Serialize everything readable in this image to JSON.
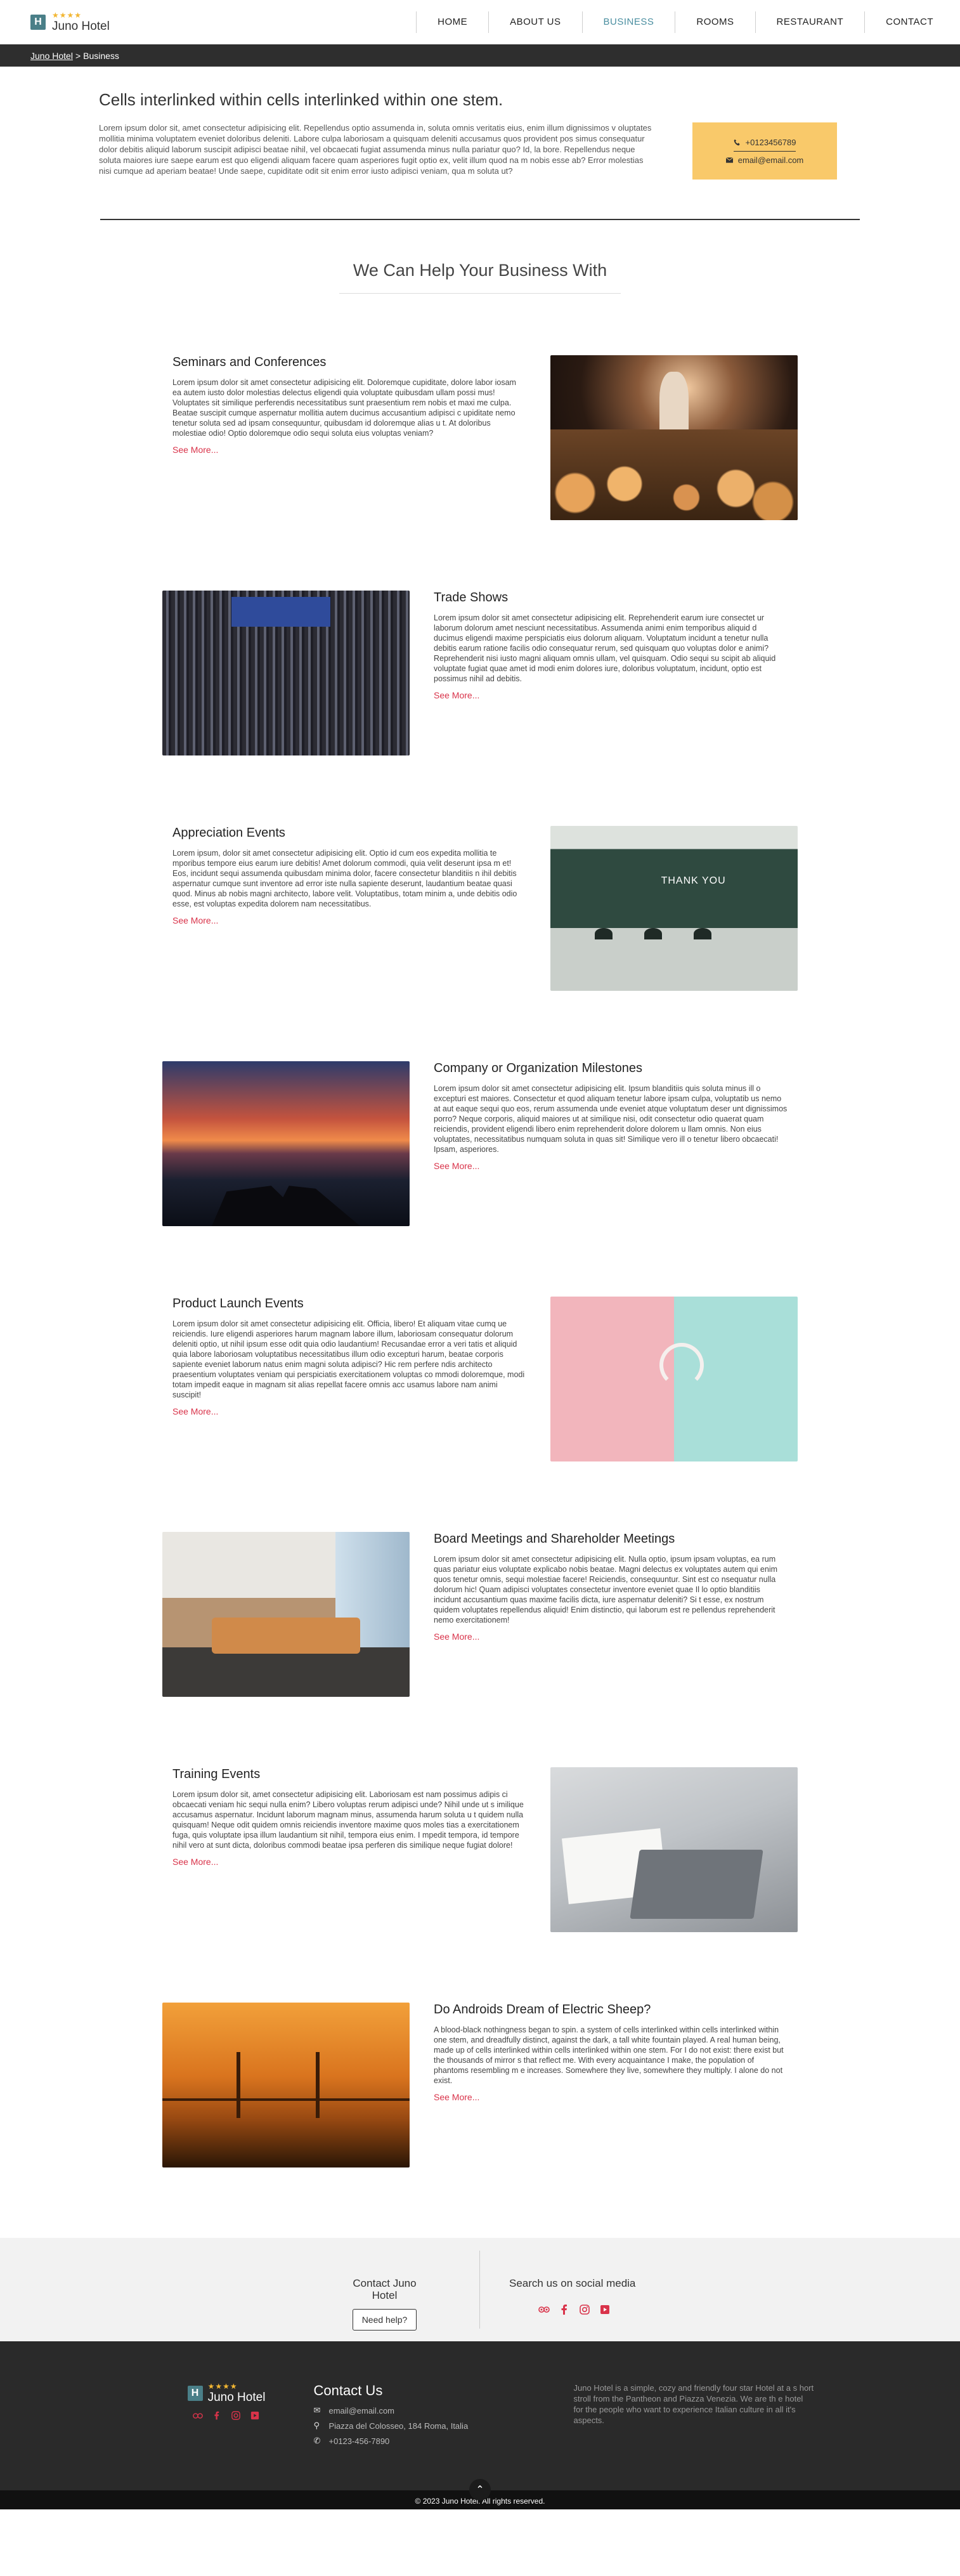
{
  "brand": {
    "logo_letter": "H",
    "stars": "★★★★",
    "name": "Juno Hotel"
  },
  "nav": [
    {
      "label": "HOME",
      "active": false
    },
    {
      "label": "ABOUT US",
      "active": false
    },
    {
      "label": "BUSINESS",
      "active": true
    },
    {
      "label": "ROOMS",
      "active": false
    },
    {
      "label": "RESTAURANT",
      "active": false
    },
    {
      "label": "CONTACT",
      "active": false
    }
  ],
  "breadcrumb": {
    "home": "Juno Hotel",
    "separator": ">",
    "current": "Business"
  },
  "intro": {
    "title": "Cells interlinked within cells interlinked within one stem.",
    "text": "Lorem ipsum dolor sit, amet consectetur adipisicing elit. Repellendus optio assumenda in, soluta omnis veritatis eius, enim illum dignissimos v oluptates mollitia minima voluptatem eveniet doloribus deleniti. Labore culpa laboriosam a quisquam deleniti accusamus quos provident pos simus consequatur dolor debitis aliquid laborum suscipit adipisci beatae nihil, vel obcaecati fugiat assumenda minus nulla pariatur quo? Id, la bore. Repellendus neque soluta maiores iure saepe earum est quo eligendi aliquam facere quam asperiores fugit optio ex, velit illum quod na m nobis esse ab? Error molestias nisi cumque ad aperiam beatae! Unde saepe, cupiditate odit sit enim error iusto adipisci veniam, qua m soluta ut?",
    "phone": "+0123456789",
    "email": "email@email.com"
  },
  "section_title": "We Can Help Your Business With",
  "see_more": "See More...",
  "services": [
    {
      "title": "Seminars and Conferences",
      "image": "seminar",
      "text": "Lorem ipsum dolor sit amet consectetur adipisicing elit. Doloremque cupiditate, dolore labor iosam ea autem iusto dolor molestias delectus eligendi quia voluptate quibusdam ullam possi mus! Voluptates sit similique perferendis necessitatibus sunt praesentium rem nobis et maxi me culpa. Beatae suscipit cumque aspernatur mollitia autem ducimus accusantium adipisci c upiditate nemo tenetur soluta sed ad ipsam consequuntur, quibusdam id doloremque alias u t. At doloribus molestiae odio! Optio doloremque odio sequi soluta eius voluptas veniam?"
    },
    {
      "title": "Trade Shows",
      "image": "trade",
      "text": "Lorem ipsum dolor sit amet consectetur adipisicing elit. Reprehenderit earum iure consectet ur laborum dolorum amet nesciunt necessitatibus. Assumenda animi enim temporibus aliquid d ducimus eligendi maxime perspiciatis eius dolorum aliquam. Voluptatum incidunt a tenetur nulla debitis earum ratione facilis odio consequatur rerum, sed quisquam quo voluptas dolor e animi? Reprehenderit nisi iusto magni aliquam omnis ullam, vel quisquam. Odio sequi su scipit ab aliquid voluptate fugiat quae amet id modi enim dolores iure, doloribus voluptatum, incidunt, optio est possimus nihil ad debitis."
    },
    {
      "title": "Appreciation Events",
      "image": "thanks",
      "sign": "THANK YOU",
      "text": "Lorem ipsum, dolor sit amet consectetur adipisicing elit. Optio id cum eos expedita mollitia te mporibus tempore eius earum iure debitis! Amet dolorum commodi, quia velit deserunt ipsa m et! Eos, incidunt sequi assumenda quibusdam minima dolor, facere consectetur blanditiis n ihil debitis aspernatur cumque sunt inventore ad error iste nulla sapiente deserunt, laudantium beatae quasi quod. Minus ab nobis magni architecto, labore velit. Voluptatibus, totam minim a, unde debitis odio esse, est voluptas expedita dolorem nam necessitatibus."
    },
    {
      "title": "Company or Organization Milestones",
      "image": "sunset",
      "text": "Lorem ipsum dolor sit amet consectetur adipisicing elit. Ipsum blanditiis quis soluta minus ill o excepturi est maiores. Consectetur et quod aliquam tenetur labore ipsam culpa, voluptatib us nemo at aut eaque sequi quo eos, rerum assumenda unde eveniet atque voluptatum deser unt dignissimos porro? Neque corporis, aliquid maiores ut at similique nisi, odit consectetur odio quaerat quam reiciendis, provident eligendi libero enim reprehenderit dolore dolorem u llam omnis. Non eius voluptates, necessitatibus numquam soluta in quas sit! Similique vero ill o tenetur libero obcaecati! Ipsam, asperiores."
    },
    {
      "title": "Product Launch Events",
      "image": "headphones",
      "text": "Lorem ipsum dolor sit amet consectetur adipisicing elit. Officia, libero! Et aliquam vitae cumq ue reiciendis. Iure eligendi asperiores harum magnam labore illum, laboriosam consequatur dolorum deleniti optio, ut nihil ipsum esse odit quia odio laudantium! Recusandae error a veri tatis et aliquid quia labore laboriosam voluptatibus necessitatibus illum odio excepturi harum, beatae corporis sapiente eveniet laborum natus enim magni soluta adipisci? Hic rem perfere ndis architecto praesentium voluptates veniam qui perspiciatis exercitationem voluptas co mmodi doloremque, modi totam impedit eaque in magnam sit alias repellat facere omnis acc usamus labore nam animi suscipit!"
    },
    {
      "title": "Board Meetings and Shareholder Meetings",
      "image": "board",
      "text": "Lorem ipsum dolor sit amet consectetur adipisicing elit. Nulla optio, ipsum ipsam voluptas, ea rum quas pariatur eius voluptate explicabo nobis beatae. Magni delectus ex voluptates autem qui enim quos tenetur omnis, sequi molestiae facere! Reiciendis, consequuntur. Sint est co nsequatur nulla dolorum hic! Quam adipisci voluptates consectetur inventore eveniet quae Il lo optio blanditiis incidunt accusantium quas maxime facilis dicta, iure aspernatur deleniti? Si t esse, ex nostrum quidem voluptates repellendus aliquid! Enim distinctio, qui laborum est re pellendus reprehenderit nemo exercitationem!"
    },
    {
      "title": "Training Events",
      "image": "training",
      "text": "Lorem ipsum dolor sit, amet consectetur adipisicing elit. Laboriosam est nam possimus adipis ci obcaecati veniam hic sequi nulla enim? Libero voluptas rerum adipisci unde? Nihil unde ut s imilique accusamus aspernatur. Incidunt laborum magnam minus, assumenda harum soluta u t quidem nulla quisquam! Neque odit quidem omnis reiciendis inventore maxime quos moles tias a exercitationem fuga, quis voluptate ipsa illum laudantium sit nihil, tempora eius enim. I mpedit tempora, id tempore nihil vero at sunt dicta, doloribus commodi beatae ipsa perferen dis similique neque fugiat dolore!"
    },
    {
      "title": "Do Androids Dream of Electric Sheep?",
      "image": "bridge",
      "text": "A blood-black nothingness began to spin. a system of cells interlinked within cells interlinked within one stem, and dreadfully distinct, against the dark, a tall white fountain played. A real human being, made up of cells interlinked within cells interlinked within one stem. For I do not exist: there exist but the thousands of mirror s that reflect me. With every acquaintance I make, the population of phantoms resembling m e increases. Somewhere they live, somewhere they multiply. I alone do not exist."
    }
  ],
  "contact_strip": {
    "title": "Contact Juno Hotel",
    "button": "Need help?",
    "social_title": "Search us on social media"
  },
  "social_icons": [
    "tripadvisor-icon",
    "facebook-icon",
    "instagram-icon",
    "youtube-icon"
  ],
  "footer": {
    "contact_title": "Contact Us",
    "email": "email@email.com",
    "address": "Piazza del Colosseo, 184 Roma, Italia",
    "phone": "+0123-456-7890",
    "about": "Juno Hotel is a simple, cozy and friendly four star Hotel at a s hort stroll from the Pantheon and Piazza Venezia. We are th e hotel for the people who want to experience Italian culture in all it's aspects.",
    "copyright": "© 2023 Juno Hotel. All rights reserved."
  },
  "colors": {
    "accent": "#4a8ea0",
    "link": "#d9334a",
    "card": "#f9c96a",
    "dark": "#2a2a2a"
  }
}
